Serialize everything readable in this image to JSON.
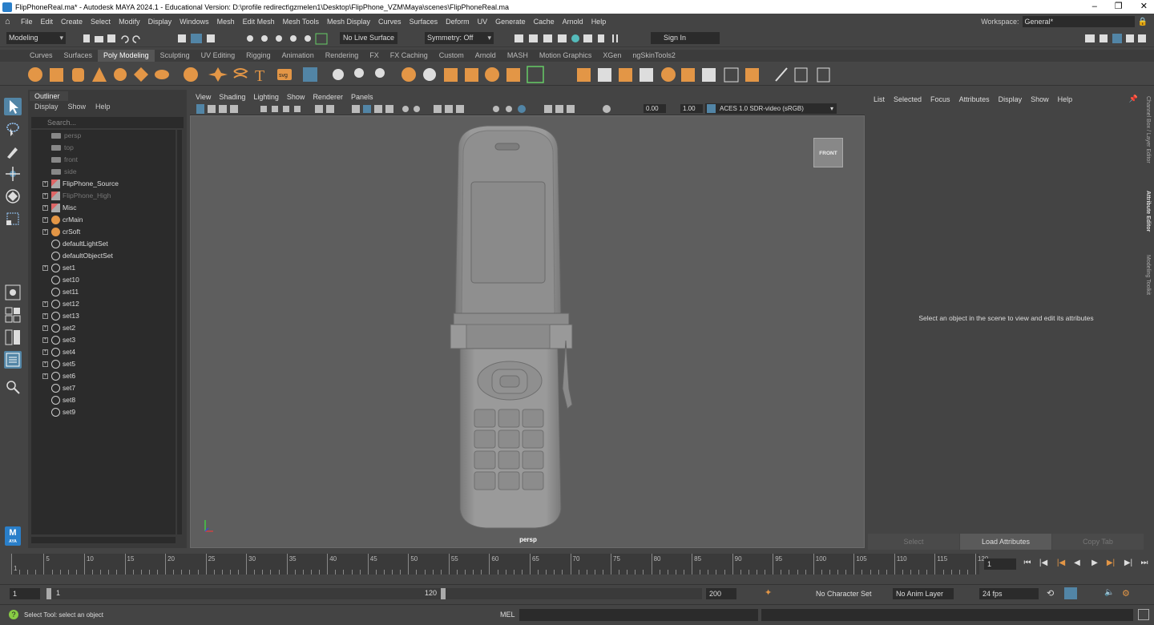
{
  "window": {
    "title": "FlipPhoneReal.ma* - Autodesk MAYA 2024.1 - Educational Version: D:\\profile redirect\\gzmelen1\\Desktop\\FlipPhone_VZM\\Maya\\scenes\\FlipPhoneReal.ma",
    "minimize": "–",
    "restore": "❐",
    "close": "✕"
  },
  "menubar": {
    "items": [
      "File",
      "Edit",
      "Create",
      "Select",
      "Modify",
      "Display",
      "Windows",
      "Mesh",
      "Edit Mesh",
      "Mesh Tools",
      "Mesh Display",
      "Curves",
      "Surfaces",
      "Deform",
      "UV",
      "Generate",
      "Cache",
      "Arnold",
      "Help"
    ],
    "workspace_label": "Workspace:",
    "workspace_value": "General*"
  },
  "statusline": {
    "mode": "Modeling",
    "live_surface": "No Live Surface",
    "symmetry": "Symmetry: Off",
    "sign_in": "Sign In"
  },
  "shelf": {
    "tabs": [
      "Curves",
      "Surfaces",
      "Poly Modeling",
      "Sculpting",
      "UV Editing",
      "Rigging",
      "Animation",
      "Rendering",
      "FX",
      "FX Caching",
      "Custom",
      "Arnold",
      "MASH",
      "Motion Graphics",
      "XGen",
      "ngSkinTools2"
    ],
    "active_tab": "Poly Modeling",
    "text_icon": "T",
    "svg_icon": "svg"
  },
  "outliner": {
    "tab": "Outliner",
    "menu": [
      "Display",
      "Show",
      "Help"
    ],
    "search_placeholder": "Search...",
    "items": [
      {
        "label": "persp",
        "type": "camera",
        "dim": true,
        "expand": false
      },
      {
        "label": "top",
        "type": "camera",
        "dim": true,
        "expand": false
      },
      {
        "label": "front",
        "type": "camera",
        "dim": true,
        "expand": false
      },
      {
        "label": "side",
        "type": "camera",
        "dim": true,
        "expand": false
      },
      {
        "label": "FlipPhone_Source",
        "type": "mesh",
        "dim": false,
        "expand": true
      },
      {
        "label": "FlipPhone_High",
        "type": "mesh",
        "dim": true,
        "expand": true
      },
      {
        "label": "Misc",
        "type": "mesh",
        "dim": false,
        "expand": true
      },
      {
        "label": "crMain",
        "type": "orange",
        "dim": false,
        "expand": true
      },
      {
        "label": "crSoft",
        "type": "orange",
        "dim": false,
        "expand": true
      },
      {
        "label": "defaultLightSet",
        "type": "set",
        "dim": false,
        "expand": false
      },
      {
        "label": "defaultObjectSet",
        "type": "set",
        "dim": false,
        "expand": false
      },
      {
        "label": "set1",
        "type": "set",
        "dim": false,
        "expand": true
      },
      {
        "label": "set10",
        "type": "set",
        "dim": false,
        "expand": false
      },
      {
        "label": "set11",
        "type": "set",
        "dim": false,
        "expand": false
      },
      {
        "label": "set12",
        "type": "set",
        "dim": false,
        "expand": true
      },
      {
        "label": "set13",
        "type": "set",
        "dim": false,
        "expand": true
      },
      {
        "label": "set2",
        "type": "set",
        "dim": false,
        "expand": true
      },
      {
        "label": "set3",
        "type": "set",
        "dim": false,
        "expand": true
      },
      {
        "label": "set4",
        "type": "set",
        "dim": false,
        "expand": true
      },
      {
        "label": "set5",
        "type": "set",
        "dim": false,
        "expand": true
      },
      {
        "label": "set6",
        "type": "set",
        "dim": false,
        "expand": true
      },
      {
        "label": "set7",
        "type": "set",
        "dim": false,
        "expand": false
      },
      {
        "label": "set8",
        "type": "set",
        "dim": false,
        "expand": false
      },
      {
        "label": "set9",
        "type": "set",
        "dim": false,
        "expand": false
      }
    ]
  },
  "viewport": {
    "menu": [
      "View",
      "Shading",
      "Lighting",
      "Show",
      "Renderer",
      "Panels"
    ],
    "exposure": "0.00",
    "gamma": "1.00",
    "color_space": "ACES 1.0 SDR-video (sRGB)",
    "camera_label": "persp",
    "viewcube": "FRONT"
  },
  "attribute_editor": {
    "menu": [
      "List",
      "Selected",
      "Focus",
      "Attributes",
      "Display",
      "Show",
      "Help"
    ],
    "message": "Select an object in the scene to view and edit its attributes",
    "buttons": [
      "Select",
      "Load Attributes",
      "Copy Tab"
    ]
  },
  "side_tabs": [
    "Channel Box / Layer Editor",
    "Attribute Editor",
    "Modeling Toolkit"
  ],
  "maya_badge": "M",
  "maya_badge_sub": "AYA",
  "timeslider": {
    "ticks": [
      "1",
      "5",
      "10",
      "15",
      "20",
      "25",
      "30",
      "35",
      "40",
      "45",
      "50",
      "55",
      "60",
      "65",
      "70",
      "75",
      "80",
      "85",
      "90",
      "95",
      "100",
      "105",
      "110",
      "115",
      "120"
    ],
    "current_frame": "1"
  },
  "range": {
    "start": "1",
    "inner_start": "1",
    "inner_end": "120",
    "end": "200",
    "character_set": "No Character Set",
    "anim_layer": "No Anim Layer",
    "fps": "24 fps"
  },
  "commandline": {
    "help": "Select Tool: select an object",
    "lang": "MEL"
  },
  "colors": {
    "accent": "#5285a6",
    "orange": "#e39646",
    "panel": "#444444",
    "viewport_bg": "#5e5e5e"
  }
}
